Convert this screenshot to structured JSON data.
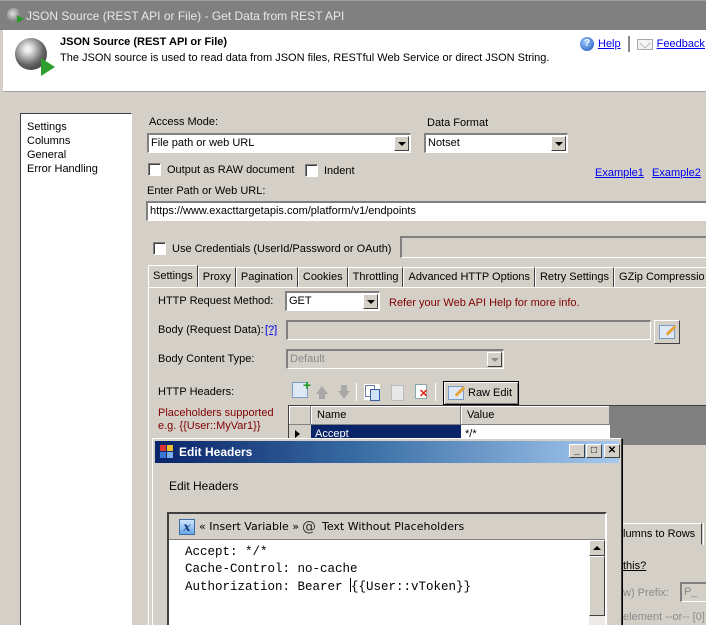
{
  "window": {
    "title": "JSON Source (REST API or File) - Get Data from REST API"
  },
  "header": {
    "title": "JSON Source (REST API or File)",
    "description": "The JSON source is used to read data from JSON files, RESTful Web Service or direct JSON String.",
    "help_label": "Help",
    "feedback_label": "Feedback"
  },
  "nav": {
    "items": [
      {
        "label": "Settings"
      },
      {
        "label": "Columns"
      },
      {
        "label": "General"
      },
      {
        "label": "Error Handling"
      }
    ]
  },
  "settings": {
    "access_mode_label": "Access Mode:",
    "access_mode_value": "File path or web URL",
    "data_format_label": "Data Format",
    "data_format_value": "Notset",
    "output_raw_label": "Output as RAW document",
    "output_raw_checked": false,
    "indent_label": "Indent",
    "indent_checked": false,
    "example1_label": "Example1",
    "example2_label": "Example2",
    "path_label": "Enter Path or Web URL:",
    "path_value": "https://www.exacttargetapis.com/platform/v1/endpoints",
    "use_credentials_label": "Use Credentials (UserId/Password or OAuth)",
    "use_credentials_checked": false,
    "credentials_value": ""
  },
  "tabs": [
    {
      "label": "Settings",
      "active": true
    },
    {
      "label": "Proxy"
    },
    {
      "label": "Pagination"
    },
    {
      "label": "Cookies"
    },
    {
      "label": "Throttling"
    },
    {
      "label": "Advanced HTTP Options"
    },
    {
      "label": "Retry Settings"
    },
    {
      "label": "GZip Compressio"
    }
  ],
  "http": {
    "method_label": "HTTP Request Method:",
    "method_value": "GET",
    "method_hint": "Refer your Web API Help for more info.",
    "body_label": "Body (Request Data):",
    "body_help_link": "[?]",
    "body_value": "",
    "body_content_type_label": "Body Content Type:",
    "body_content_type_value": "Default",
    "headers_label": "HTTP Headers:",
    "placeholders_note_line1": "Placeholders supported",
    "placeholders_note_line2": "e.g. {{User::MyVar1}}",
    "raw_edit_label": "Raw Edit",
    "grid": {
      "columns": [
        "Name",
        "Value"
      ],
      "rows": [
        {
          "name": "Accept",
          "value": "*/*"
        }
      ]
    }
  },
  "behind_modal": {
    "tab_fragment": "lumns to Rows",
    "link_fragment": "this?",
    "prefix_fragment": "w) Prefix:",
    "prefix_value": "P_",
    "footer_fragment": "element --or-- [0]."
  },
  "modal": {
    "title": "Edit Headers",
    "subtitle": "Edit Headers",
    "insert_variable_label": "« Insert Variable »",
    "text_without_placeholders_label": "Text Without Placeholders",
    "lines": [
      "Accept: */*",
      "Cache-Control: no-cache",
      "Authorization: Bearer "
    ],
    "caret_after": "{{User::vToken}}",
    "minimize_glyph": "_",
    "maximize_glyph": "□",
    "close_glyph": "✕"
  }
}
